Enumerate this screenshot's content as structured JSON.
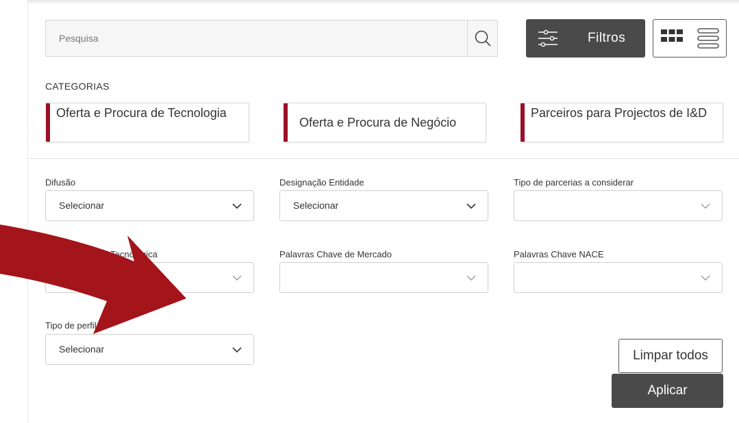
{
  "search": {
    "placeholder": "Pesquisa"
  },
  "toolbar": {
    "filters_label": "Filtros"
  },
  "categories": {
    "title": "CATEGORIAS",
    "items": [
      {
        "label": "Oferta e Procura de Tecnologia"
      },
      {
        "label": "Oferta e Procura de Negócio"
      },
      {
        "label": "Parceiros para Projectos de I&D"
      }
    ]
  },
  "filters": [
    {
      "label": "Difusão",
      "value": "Selecionar"
    },
    {
      "label": "Designação Entidade",
      "value": "Selecionar"
    },
    {
      "label": "Tipo de parcerias a considerar",
      "value": ""
    },
    {
      "label": "Palavras Chave Tecnológica",
      "value": ""
    },
    {
      "label": "Palavras Chave de Mercado",
      "value": ""
    },
    {
      "label": "Palavras Chave NACE",
      "value": ""
    },
    {
      "label": "Tipo de perfil",
      "value": "Selecionar"
    }
  ],
  "actions": {
    "clear_label": "Limpar todos",
    "apply_label": "Aplicar"
  },
  "colors": {
    "accent": "#9b1028",
    "dark_button": "#4a4a4a",
    "arrow": "#a3141b"
  }
}
